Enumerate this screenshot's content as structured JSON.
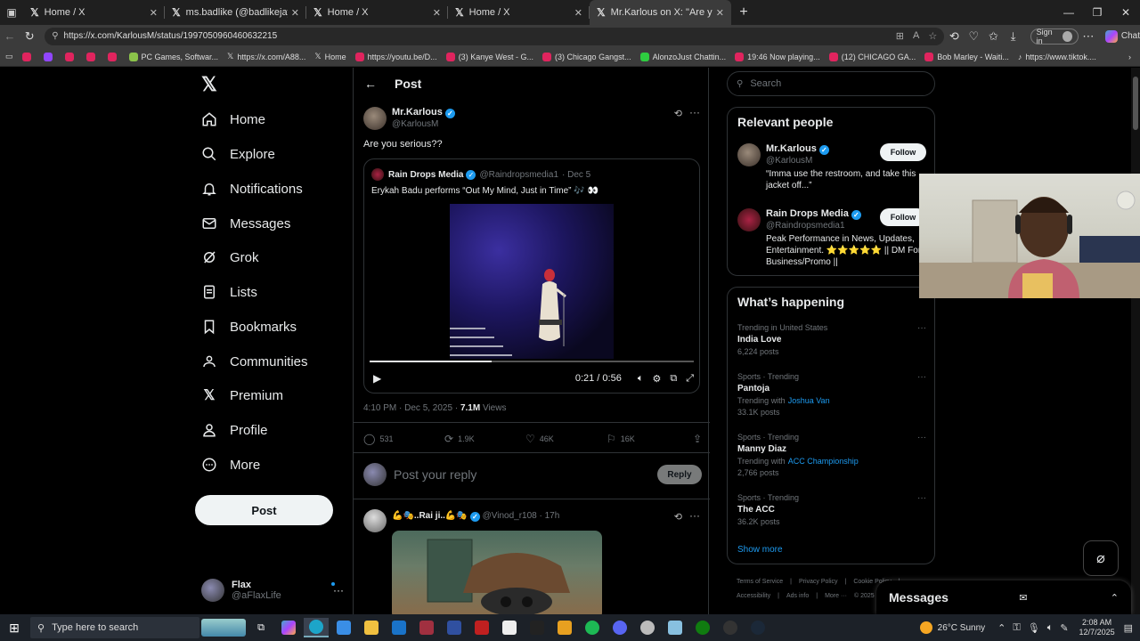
{
  "browser": {
    "tabs": [
      {
        "title": "Home / X",
        "active": false
      },
      {
        "title": "ms.badlike (@badlikejay) / X",
        "active": false
      },
      {
        "title": "Home / X",
        "active": false
      },
      {
        "title": "Home / X",
        "active": false
      },
      {
        "title": "Mr.Karlous on X: \"Are you serious",
        "active": true
      }
    ],
    "url": "https://x.com/KarlousM/status/1997050960460632215",
    "sign_in": "Sign in",
    "chat": "Chat",
    "bookmarks": [
      {
        "label": "",
        "color": "#e0245e"
      },
      {
        "label": "",
        "color": "#9146ff"
      },
      {
        "label": "",
        "color": "#e0245e"
      },
      {
        "label": "",
        "color": "#e0245e"
      },
      {
        "label": "",
        "color": "#e0245e"
      },
      {
        "label": "PC Games, Softwar...",
        "color": "#8bc34a"
      },
      {
        "label": "https://x.com/A88...",
        "color": "#ffffff"
      },
      {
        "label": "Home",
        "color": "#ffffff"
      },
      {
        "label": "https://youtu.be/D...",
        "color": "#e0245e"
      },
      {
        "label": "(3) Kanye West - G...",
        "color": "#e0245e"
      },
      {
        "label": "(3) Chicago Gangst...",
        "color": "#e0245e"
      },
      {
        "label": "AlonzoJust Chattin...",
        "color": "#2ecc40"
      },
      {
        "label": "19:46 Now playing...",
        "color": "#e0245e"
      },
      {
        "label": "(12) CHICAGO GA...",
        "color": "#e0245e"
      },
      {
        "label": "Bob Marley - Waiti...",
        "color": "#e0245e"
      },
      {
        "label": "https://www.tiktok....",
        "color": "#111111"
      }
    ]
  },
  "nav": {
    "items": [
      {
        "label": "Home",
        "icon": "home-icon"
      },
      {
        "label": "Explore",
        "icon": "search-icon"
      },
      {
        "label": "Notifications",
        "icon": "bell-icon"
      },
      {
        "label": "Messages",
        "icon": "mail-icon"
      },
      {
        "label": "Grok",
        "icon": "grok-icon"
      },
      {
        "label": "Lists",
        "icon": "list-icon"
      },
      {
        "label": "Bookmarks",
        "icon": "bookmark-icon"
      },
      {
        "label": "Communities",
        "icon": "people-icon"
      },
      {
        "label": "Premium",
        "icon": "x-icon"
      },
      {
        "label": "Profile",
        "icon": "person-icon"
      },
      {
        "label": "More",
        "icon": "more-circle-icon"
      }
    ],
    "post_label": "Post",
    "account": {
      "display_name": "Flax",
      "handle": "@aFlaxLife"
    }
  },
  "post": {
    "header_title": "Post",
    "author": "Mr.Karlous",
    "handle": "@KarlousM",
    "text": "Are you serious??",
    "quote": {
      "author": "Rain Drops Media",
      "handle": "@Raindropsmedia1",
      "date": "· Dec 5",
      "text": "Erykah Badu performs “Out My Mind, Just in Time” 🎶 👀",
      "video_time": "0:21 / 0:56",
      "progress": 0.375
    },
    "time": "4:10 PM · Dec 5, 2025 · ",
    "views_count": "7.1M",
    "views_label": " Views",
    "stats": {
      "replies": "531",
      "reposts": "1.9K",
      "likes": "46K",
      "bookmarks": "16K"
    },
    "reply_placeholder": "Post your reply",
    "reply_button": "Reply"
  },
  "reply": {
    "author": "💪🎭..Rai ji..💪🎭",
    "handle": "@Vinod_r108 · 17h"
  },
  "sidebar": {
    "search_placeholder": "Search",
    "relevant_title": "Relevant people",
    "people": [
      {
        "name": "Mr.Karlous",
        "handle": "@KarlousM",
        "bio": "“Imma use the restroom, and take this jacket off...”",
        "follow": "Follow"
      },
      {
        "name": "Rain Drops Media",
        "handle": "@Raindropsmedia1",
        "bio": "Peak Performance in News, Updates, Entertainment. ⭐⭐⭐⭐⭐ || DM For Business/Promo ||",
        "follow": "Follow"
      }
    ],
    "happening_title": "What’s happening",
    "trends": [
      {
        "context": "Trending in United States",
        "title": "India Love",
        "with_label": "",
        "with_link": "",
        "posts": "6,224 posts"
      },
      {
        "context": "Sports · Trending",
        "title": "Pantoja",
        "with_label": "Trending with",
        "with_link": "Joshua Van",
        "posts": "33.1K posts"
      },
      {
        "context": "Sports · Trending",
        "title": "Manny Diaz",
        "with_label": "Trending with",
        "with_link": "ACC Championship",
        "posts": "2,766 posts"
      },
      {
        "context": "Sports · Trending",
        "title": "The ACC",
        "with_label": "",
        "with_link": "",
        "posts": "36.2K posts"
      }
    ],
    "show_more": "Show more",
    "footer": [
      "Terms of Service",
      "|",
      "Privacy Policy",
      "|",
      "Cookie Policy",
      "|",
      "Accessibility",
      "|",
      "Ads info",
      "|",
      "More ···",
      "© 2025"
    ]
  },
  "messages_drawer": {
    "title": "Messages"
  },
  "taskbar": {
    "search_placeholder": "Type here to search",
    "weather": "26°C  Sunny",
    "time": "2:08 AM",
    "date": "12/7/2025"
  }
}
